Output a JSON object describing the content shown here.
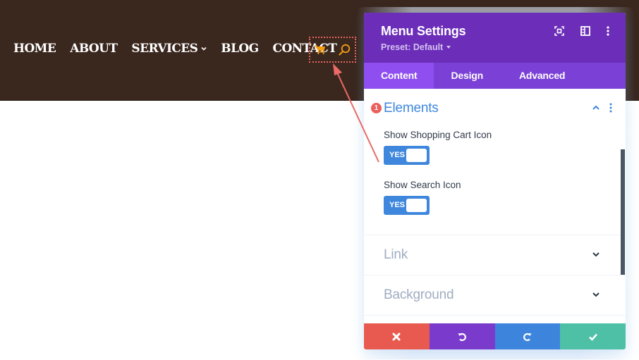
{
  "site": {
    "nav": [
      {
        "label": "HOME"
      },
      {
        "label": "ABOUT"
      },
      {
        "label": "SERVICES",
        "has_dropdown": true
      },
      {
        "label": "BLOG"
      },
      {
        "label": "CONTACT"
      }
    ],
    "icons": [
      "cart-icon",
      "search-icon"
    ],
    "colors": {
      "header_bg": "#3a271e",
      "icon_color": "#f39c12",
      "highlight": "#e9645f"
    }
  },
  "panel": {
    "title": "Menu Settings",
    "preset": "Preset: Default",
    "header_icons": [
      "focus-icon",
      "split-view-icon",
      "more-icon"
    ],
    "tabs": [
      {
        "label": "Content",
        "active": true
      },
      {
        "label": "Design",
        "active": false
      },
      {
        "label": "Advanced",
        "active": false
      }
    ],
    "sections": [
      {
        "title": "Elements",
        "open": true,
        "badge": "1",
        "fields": [
          {
            "label": "Show Shopping Cart Icon",
            "value": "YES"
          },
          {
            "label": "Show Search Icon",
            "value": "YES"
          }
        ]
      },
      {
        "title": "Link",
        "open": false
      },
      {
        "title": "Background",
        "open": false
      }
    ],
    "footer": [
      {
        "name": "discard",
        "icon": "close-icon",
        "color": "#e85a50"
      },
      {
        "name": "undo",
        "icon": "undo-icon",
        "color": "#7a3bcd"
      },
      {
        "name": "redo",
        "icon": "redo-icon",
        "color": "#3d85dc"
      },
      {
        "name": "save",
        "icon": "check-icon",
        "color": "#4ec0a6"
      }
    ],
    "colors": {
      "header": "#6c2eb9",
      "tabs": "#7b40d6",
      "active_tab": "#8f4ef0",
      "accent": "#3e87dc"
    }
  }
}
